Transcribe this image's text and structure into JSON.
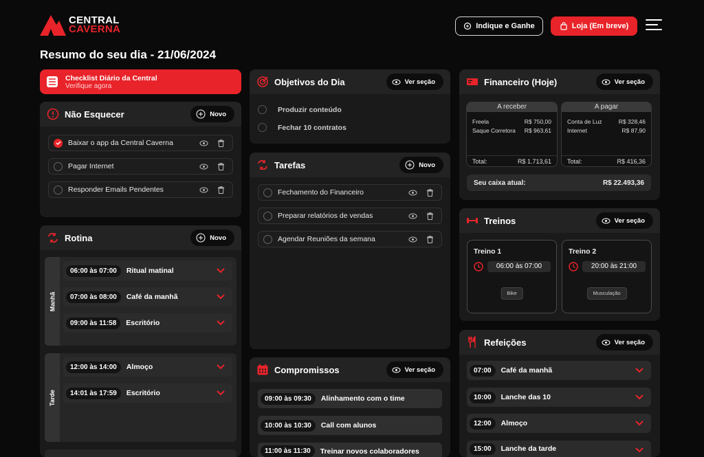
{
  "header": {
    "logo_line1": "CENTRAL",
    "logo_line2": "CAVERNA",
    "indique_label": "Indique e Ganhe",
    "loja_label": "Loja (Em breve)"
  },
  "page_title": "Resumo do seu dia - 21/06/2024",
  "checklist": {
    "title": "Checklist Diário da Central",
    "subtitle": "Verifique agora"
  },
  "nao_esquecer": {
    "title": "Não Esquecer",
    "action": "Novo",
    "items": [
      {
        "label": "Baixar o app da Central Caverna",
        "checked": true
      },
      {
        "label": "Pagar Internet",
        "checked": false
      },
      {
        "label": "Responder Emails Pendentes",
        "checked": false
      }
    ]
  },
  "rotina": {
    "title": "Rotina",
    "action": "Novo",
    "periods": [
      {
        "label": "Manhã",
        "items": [
          {
            "time": "06:00 às 07:00",
            "label": "Ritual matinal"
          },
          {
            "time": "07:00 às 08:00",
            "label": "Café da manhã"
          },
          {
            "time": "09:00 às 11:58",
            "label": "Escritório"
          }
        ]
      },
      {
        "label": "Tarde",
        "items": [
          {
            "time": "12:00 às 14:00",
            "label": "Almoço"
          },
          {
            "time": "14:01 às 17:59",
            "label": "Escritório"
          }
        ]
      }
    ]
  },
  "objetivos": {
    "title": "Objetivos do Dia",
    "action": "Ver seção",
    "items": [
      "Produzir conteúdo",
      "Fechar 10 contratos"
    ]
  },
  "tarefas": {
    "title": "Tarefas",
    "action": "Novo",
    "items": [
      "Fechamento do Financeiro",
      "Preparar relatórios de vendas",
      "Agendar Reuniões da semana"
    ]
  },
  "compromissos": {
    "title": "Compromissos",
    "action": "Ver seção",
    "items": [
      {
        "time": "09:00 às 09:30",
        "label": "Alinhamento com o time"
      },
      {
        "time": "10:00 às 10:30",
        "label": "Call com alunos"
      },
      {
        "time": "11:00 às 11:30",
        "label": "Treinar novos colaboradores"
      }
    ]
  },
  "financeiro": {
    "title": "Financeiro (Hoje)",
    "action": "Ver seção",
    "receber": {
      "title": "A receber",
      "items": [
        {
          "k": "Freela",
          "v": "R$ 750,00"
        },
        {
          "k": "Saque Corretora",
          "v": "R$ 963,61"
        }
      ],
      "total_label": "Total:",
      "total": "R$ 1.713,61"
    },
    "pagar": {
      "title": "A pagar",
      "items": [
        {
          "k": "Conta de Luz",
          "v": "R$ 328,46"
        },
        {
          "k": "Internet",
          "v": "R$ 87,90"
        }
      ],
      "total_label": "Total:",
      "total": "R$ 416,36"
    },
    "caixa_label": "Seu caixa atual:",
    "caixa_value": "R$ 22.493,36"
  },
  "treinos": {
    "title": "Treinos",
    "action": "Ver seção",
    "items": [
      {
        "name": "Treino 1",
        "time": "06:00 às 07:00",
        "tag": "Bike"
      },
      {
        "name": "Treino 2",
        "time": "20:00 às 21:00",
        "tag": "Musculação"
      }
    ]
  },
  "refeicoes": {
    "title": "Refeições",
    "action": "Ver seção",
    "items": [
      {
        "time": "07:00",
        "label": "Café da manhã"
      },
      {
        "time": "10:00",
        "label": "Lanche das 10"
      },
      {
        "time": "12:00",
        "label": "Almoço"
      },
      {
        "time": "15:00",
        "label": "Lanche da tarde"
      }
    ]
  },
  "colors": {
    "accent": "#e8242a",
    "bg": "#0a0a0a",
    "card": "#1a1a1a"
  }
}
